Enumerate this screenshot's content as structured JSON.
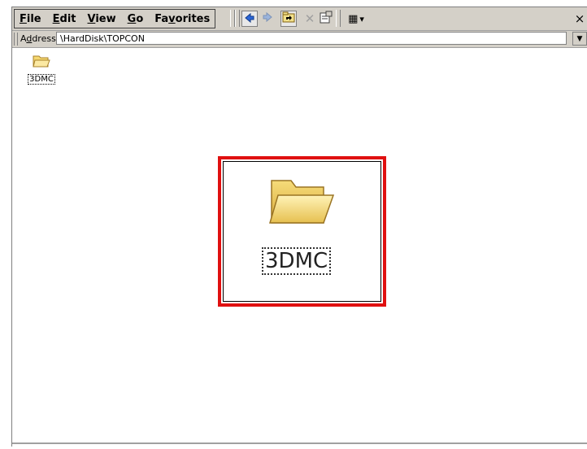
{
  "menubar": {
    "items": [
      {
        "label": "File",
        "u": "F",
        "rest": "ile"
      },
      {
        "label": "Edit",
        "u": "E",
        "rest": "dit"
      },
      {
        "label": "View",
        "u": "V",
        "rest": "iew"
      },
      {
        "label": "Go",
        "u": "G",
        "rest": "o"
      },
      {
        "label": "Favorites",
        "pre": "Fa",
        "u": "v",
        "rest": "orites"
      }
    ],
    "close_label": "×"
  },
  "toolbar": {
    "back_icon": "◆",
    "forward_icon": "◆",
    "up_icon": "folder-up-icon",
    "delete_icon": "✕",
    "properties_icon": "properties-icon",
    "views_icon": "▦",
    "views_dropdown": "▾"
  },
  "address": {
    "label_pre": "A",
    "label_u": "d",
    "label_rest": "dress",
    "value": "\\HardDisk\\TOPCON",
    "dropdown": "▼"
  },
  "files": [
    {
      "name": "3DMC",
      "icon": "folder-icon"
    }
  ],
  "zoom": {
    "name": "3DMC",
    "icon": "folder-icon",
    "border_color": "#e01010"
  }
}
